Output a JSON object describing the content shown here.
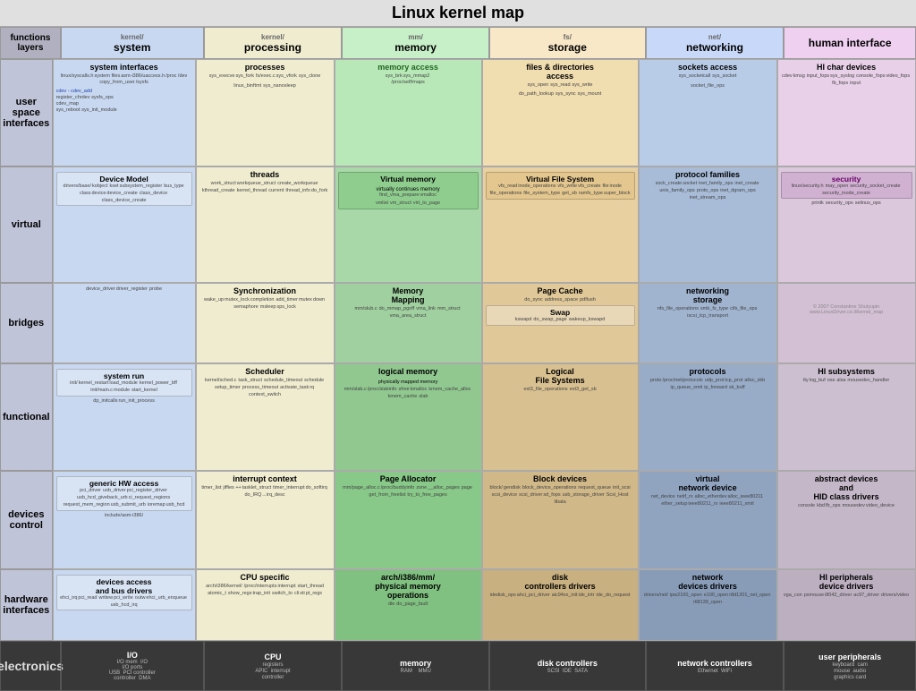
{
  "title": "Linux kernel map",
  "columns": {
    "functions_layers": "functions\nlayers",
    "system": "system",
    "processing": "processing",
    "memory": "memory",
    "storage": "storage",
    "networking": "networking",
    "human_interface": "human\ninterface"
  },
  "rows": {
    "user_space": "user space\ninterfaces",
    "virtual": "virtual",
    "bridges": "bridges",
    "functional": "functional",
    "devices_control": "devices\ncontrol",
    "hardware_interfaces": "hardware\ninterfaces"
  },
  "electronics": {
    "label": "electronics",
    "io": "I/O",
    "cpu": "CPU",
    "memory": "memory",
    "disk_controllers": "disk controllers",
    "network_controllers": "network controllers",
    "user_peripherals": "user peripherals"
  }
}
